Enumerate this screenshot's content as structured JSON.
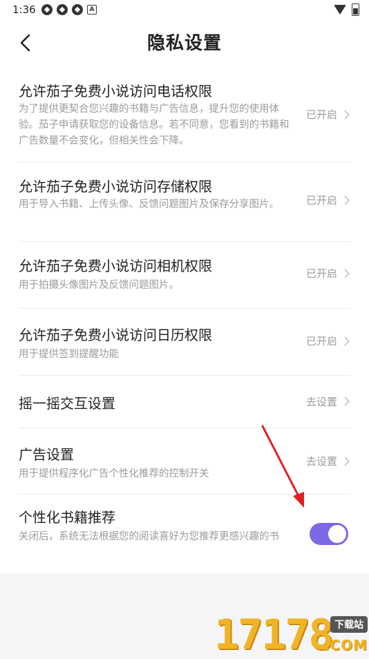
{
  "status_bar": {
    "time": "1:36",
    "notif_icons": [
      "app-icon",
      "app-icon",
      "app-icon",
      "a-icon"
    ],
    "system_icons": [
      "wifi-icon",
      "battery-icon"
    ]
  },
  "header": {
    "title": "隐私设置",
    "back_icon": "chevron-left-icon"
  },
  "settings": [
    {
      "title": "允许茄子免费小说访问电话权限",
      "description": "为了提供更契合您兴趣的书籍与广告信息，提升您的使用体验。茄子申请获取您的设备信息。若不同意，您看到的书籍和广告数量不会变化，但相关性会下降。",
      "status": "已开启"
    },
    {
      "title": "允许茄子免费小说访问存储权限",
      "description": "用于导入书籍、上传头像、反馈问题图片及保存分享图片。",
      "status": "已开启"
    },
    {
      "title": "允许茄子免费小说访问相机权限",
      "description": "用于拍摄头像图片及反馈问题图片。",
      "status": "已开启"
    },
    {
      "title": "允许茄子免费小说访问日历权限",
      "description": "用于提供签到提醒功能",
      "status": "已开启"
    },
    {
      "title": "摇一摇交互设置",
      "description": "",
      "status": "去设置"
    },
    {
      "title": "广告设置",
      "description": "用于提供程序化广告个性化推荐的控制开关",
      "status": "去设置"
    },
    {
      "title": "个性化书籍推荐",
      "description": "关闭后，系统无法根据您的阅读喜好为您推荐更感兴趣的书",
      "toggle_on": true
    }
  ],
  "watermark": {
    "number": "17178",
    "badge": "下载站",
    "suffix": ".COM"
  },
  "colors": {
    "toggle_on": "#7d68e6",
    "annotation_arrow": "#e02020",
    "secondary_text": "#9b9b9b"
  }
}
